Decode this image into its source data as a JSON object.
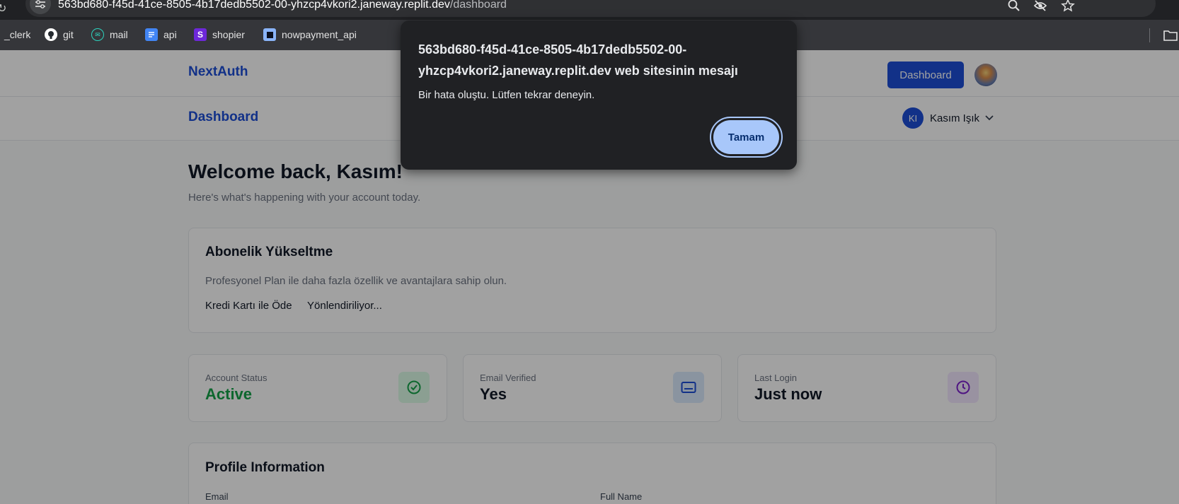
{
  "browser": {
    "url_host": "563bd680-f45d-41ce-8505-4b17dedb5502-00-yhzcp4vkori2.janeway.replit.dev",
    "url_path": "/dashboard",
    "bookmarks": [
      {
        "label": "_clerk",
        "icon": "none"
      },
      {
        "label": "git",
        "icon": "github-icon"
      },
      {
        "label": "mail",
        "icon": "mail-icon"
      },
      {
        "label": "api",
        "icon": "doc-icon"
      },
      {
        "label": "shopier",
        "icon": "shopier-icon",
        "icon_letter": "S"
      },
      {
        "label": "nowpayment_api",
        "icon": "nowpayment-icon"
      }
    ]
  },
  "topnav": {
    "brand": "NextAuth",
    "dashboard_button": "Dashboard"
  },
  "subnav": {
    "title": "Dashboard",
    "user_initials": "KI",
    "user_name": "Kasım Işık"
  },
  "main": {
    "welcome": "Welcome back, Kasım!",
    "welcome_sub": "Here's what's happening with your account today.",
    "upgrade": {
      "title": "Abonelik Yükseltme",
      "description": "Profesyonel Plan ile daha fazla özellik ve avantajlara sahip olun.",
      "pay_label": "Kredi Kartı ile Öde",
      "status": "Yönlendiriliyor..."
    },
    "stats": [
      {
        "label": "Account Status",
        "value": "Active",
        "value_color": "#16a34a",
        "icon": "check-circle-icon",
        "icon_color": "#16a34a",
        "icon_bg": "#dcfce7"
      },
      {
        "label": "Email Verified",
        "value": "Yes",
        "value_color": "#111827",
        "icon": "card-icon",
        "icon_color": "#1d4ed8",
        "icon_bg": "#dbeafe"
      },
      {
        "label": "Last Login",
        "value": "Just now",
        "value_color": "#111827",
        "icon": "clock-icon",
        "icon_color": "#7e22ce",
        "icon_bg": "#f3e8ff"
      }
    ],
    "profile": {
      "title": "Profile Information",
      "email_label": "Email",
      "fullname_label": "Full Name"
    }
  },
  "dialog": {
    "title": "563bd680-f45d-41ce-8505-4b17dedb5502-00-yhzcp4vkori2.janeway.replit.dev web sitesinin mesajı",
    "message": "Bir hata oluştu. Lütfen tekrar deneyin.",
    "ok_label": "Tamam"
  },
  "colors": {
    "accent": "#1d4ed8",
    "dialog_bg": "#202124",
    "dialog_button": "#a8c7fa"
  }
}
